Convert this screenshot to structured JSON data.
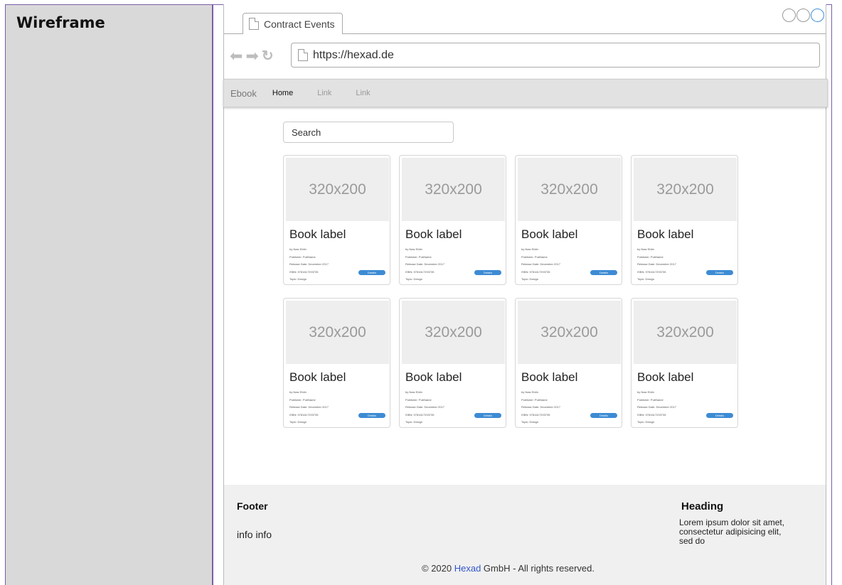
{
  "document": {
    "left_title": "Wireframe"
  },
  "browser": {
    "tab_title": "Contract Events",
    "url": "https://hexad.de"
  },
  "navbar": {
    "brand": "Ebook",
    "links": [
      {
        "label": "Home",
        "active": true
      },
      {
        "label": "Link",
        "active": false
      },
      {
        "label": "Link",
        "active": false
      }
    ]
  },
  "search": {
    "value": "Search"
  },
  "cards": [
    {
      "image_text": "320x200",
      "title": "Book label",
      "author": "by Nasr Eldin",
      "publisher": "Publisher: PubName",
      "release": "Release Date: December 2017",
      "isbn": "ISBN: 9781617293735",
      "topic": "Topic: Design",
      "button": "Details"
    },
    {
      "image_text": "320x200",
      "title": "Book label",
      "author": "by Nasr Eldin",
      "publisher": "Publisher: PubName",
      "release": "Release Date: December 2017",
      "isbn": "ISBN: 9781617293735",
      "topic": "Topic: Design",
      "button": "Details"
    },
    {
      "image_text": "320x200",
      "title": "Book label",
      "author": "by Nasr Eldin",
      "publisher": "Publisher: PubName",
      "release": "Release Date: December 2017",
      "isbn": "ISBN: 9781617293735",
      "topic": "Topic: Design",
      "button": "Details"
    },
    {
      "image_text": "320x200",
      "title": "Book label",
      "author": "by Nasr Eldin",
      "publisher": "Publisher: PubName",
      "release": "Release Date: December 2017",
      "isbn": "ISBN: 9781617293735",
      "topic": "Topic: Design",
      "button": "Details"
    },
    {
      "image_text": "320x200",
      "title": "Book label",
      "author": "by Nasr Eldin",
      "publisher": "Publisher: PubName",
      "release": "Release Date: December 2017",
      "isbn": "ISBN: 9781617293735",
      "topic": "Topic: Design",
      "button": "Details"
    },
    {
      "image_text": "320x200",
      "title": "Book label",
      "author": "by Nasr Eldin",
      "publisher": "Publisher: PubName",
      "release": "Release Date: December 2017",
      "isbn": "ISBN: 9781617293735",
      "topic": "Topic: Design",
      "button": "Details"
    },
    {
      "image_text": "320x200",
      "title": "Book label",
      "author": "by Nasr Eldin",
      "publisher": "Publisher: PubName",
      "release": "Release Date: December 2017",
      "isbn": "ISBN: 9781617293735",
      "topic": "Topic: Design",
      "button": "Details"
    },
    {
      "image_text": "320x200",
      "title": "Book label",
      "author": "by Nasr Eldin",
      "publisher": "Publisher: PubName",
      "release": "Release Date: December 2017",
      "isbn": "ISBN: 9781617293735",
      "topic": "Topic: Design",
      "button": "Details"
    }
  ],
  "footer": {
    "title": "Footer",
    "info": "info info",
    "heading": "Heading",
    "text": "Lorem ipsum dolor sit amet, consectetur adipisicing elit, sed do",
    "copyright_prefix": "© 2020 ",
    "copyright_brand": "Hexad",
    "copyright_suffix": " GmbH - All rights reserved."
  },
  "colors": {
    "accent": "#3d8bd4",
    "doc_border": "#7b5ea7",
    "doc_left_bg": "#d9d9d9",
    "link": "#3355cc"
  },
  "icons": [
    "page-icon",
    "back-arrow-icon",
    "forward-arrow-icon",
    "reload-icon",
    "window-control-icon"
  ]
}
